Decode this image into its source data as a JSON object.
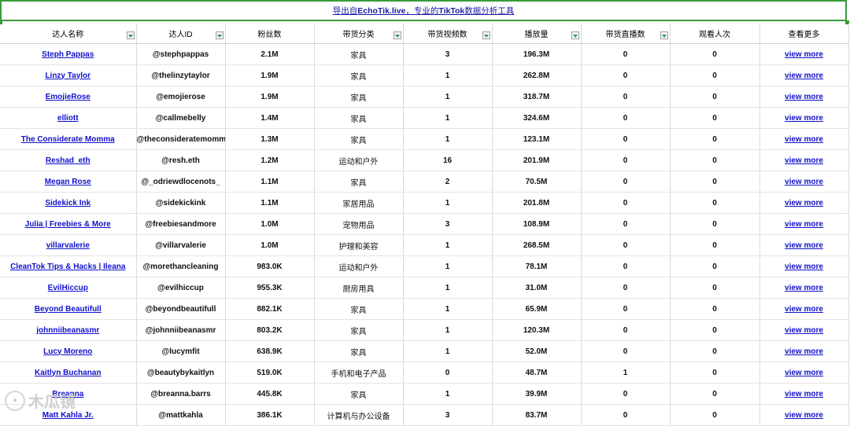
{
  "banner": {
    "prefix": "导出自",
    "site": "EchoTik.live",
    "middle": "，专业的",
    "product": "TikTok",
    "suffix": "数据分析工具"
  },
  "headers": [
    "达人名称",
    "达人ID",
    "粉丝数",
    "带货分类",
    "带货视频数",
    "播放量",
    "带货直播数",
    "观看人次",
    "查看更多"
  ],
  "rows": [
    {
      "name": "Steph Pappas",
      "id": "@stephpappas",
      "fans": "2.1M",
      "category": "家具",
      "videos": "3",
      "plays": "196.3M",
      "lives": "0",
      "viewers": "0",
      "more": "view more"
    },
    {
      "name": "Linzy Taylor",
      "id": "@thelinzytaylor",
      "fans": "1.9M",
      "category": "家具",
      "videos": "1",
      "plays": "262.8M",
      "lives": "0",
      "viewers": "0",
      "more": "view more"
    },
    {
      "name": "EmojieRose",
      "id": "@emojierose",
      "fans": "1.9M",
      "category": "家具",
      "videos": "1",
      "plays": "318.7M",
      "lives": "0",
      "viewers": "0",
      "more": "view more"
    },
    {
      "name": "elliott",
      "id": "@callmebelly",
      "fans": "1.4M",
      "category": "家具",
      "videos": "1",
      "plays": "324.6M",
      "lives": "0",
      "viewers": "0",
      "more": "view more"
    },
    {
      "name": "The Considerate Momma",
      "id": "@theconsideratemomma",
      "fans": "1.3M",
      "category": "家具",
      "videos": "1",
      "plays": "123.1M",
      "lives": "0",
      "viewers": "0",
      "more": "view more"
    },
    {
      "name": "Reshad_eth",
      "id": "@resh.eth",
      "fans": "1.2M",
      "category": "运动和户外",
      "videos": "16",
      "plays": "201.9M",
      "lives": "0",
      "viewers": "0",
      "more": "view more"
    },
    {
      "name": "Megan Rose",
      "id": "@_odriewdlocenots_",
      "fans": "1.1M",
      "category": "家具",
      "videos": "2",
      "plays": "70.5M",
      "lives": "0",
      "viewers": "0",
      "more": "view more"
    },
    {
      "name": "Sidekick Ink",
      "id": "@sidekickink",
      "fans": "1.1M",
      "category": "家居用品",
      "videos": "1",
      "plays": "201.8M",
      "lives": "0",
      "viewers": "0",
      "more": "view more"
    },
    {
      "name": "Julia | Freebies & More",
      "id": "@freebiesandmore",
      "fans": "1.0M",
      "category": "宠物用品",
      "videos": "3",
      "plays": "108.9M",
      "lives": "0",
      "viewers": "0",
      "more": "view more"
    },
    {
      "name": "villarvalerie",
      "id": "@villarvalerie",
      "fans": "1.0M",
      "category": "护理和美容",
      "videos": "1",
      "plays": "268.5M",
      "lives": "0",
      "viewers": "0",
      "more": "view more"
    },
    {
      "name": "CleanTok Tips & Hacks | Ileana",
      "id": "@morethancleaning",
      "fans": "983.0K",
      "category": "运动和户外",
      "videos": "1",
      "plays": "78.1M",
      "lives": "0",
      "viewers": "0",
      "more": "view more"
    },
    {
      "name": "EvilHiccup",
      "id": "@evilhiccup",
      "fans": "955.3K",
      "category": "厨房用具",
      "videos": "1",
      "plays": "31.0M",
      "lives": "0",
      "viewers": "0",
      "more": "view more"
    },
    {
      "name": "Beyond Beautifull",
      "id": "@beyondbeautifull",
      "fans": "882.1K",
      "category": "家具",
      "videos": "1",
      "plays": "65.9M",
      "lives": "0",
      "viewers": "0",
      "more": "view more"
    },
    {
      "name": "johnniibeanasmr",
      "id": "@johnniibeanasmr",
      "fans": "803.2K",
      "category": "家具",
      "videos": "1",
      "plays": "120.3M",
      "lives": "0",
      "viewers": "0",
      "more": "view more"
    },
    {
      "name": "Lucy Moreno",
      "id": "@lucymfit",
      "fans": "638.9K",
      "category": "家具",
      "videos": "1",
      "plays": "52.0M",
      "lives": "0",
      "viewers": "0",
      "more": "view more"
    },
    {
      "name": "Kaitlyn Buchanan",
      "id": "@beautybykaitlyn",
      "fans": "519.0K",
      "category": "手机和电子产品",
      "videos": "0",
      "plays": "48.7M",
      "lives": "1",
      "viewers": "0",
      "more": "view more"
    },
    {
      "name": "Breanna",
      "id": "@breanna.barrs",
      "fans": "445.8K",
      "category": "家具",
      "videos": "1",
      "plays": "39.9M",
      "lives": "0",
      "viewers": "0",
      "more": "view more"
    },
    {
      "name": "Matt Kahla Jr.",
      "id": "@mattkahla",
      "fans": "386.1K",
      "category": "计算机与办公设备",
      "videos": "3",
      "plays": "83.7M",
      "lives": "0",
      "viewers": "0",
      "more": "view more"
    }
  ],
  "watermark": {
    "text": "木瓜镜"
  },
  "colors": {
    "link": "#1111cc",
    "banner_border": "#3a9a3a",
    "filter_arrow": "#2f9a6b"
  }
}
